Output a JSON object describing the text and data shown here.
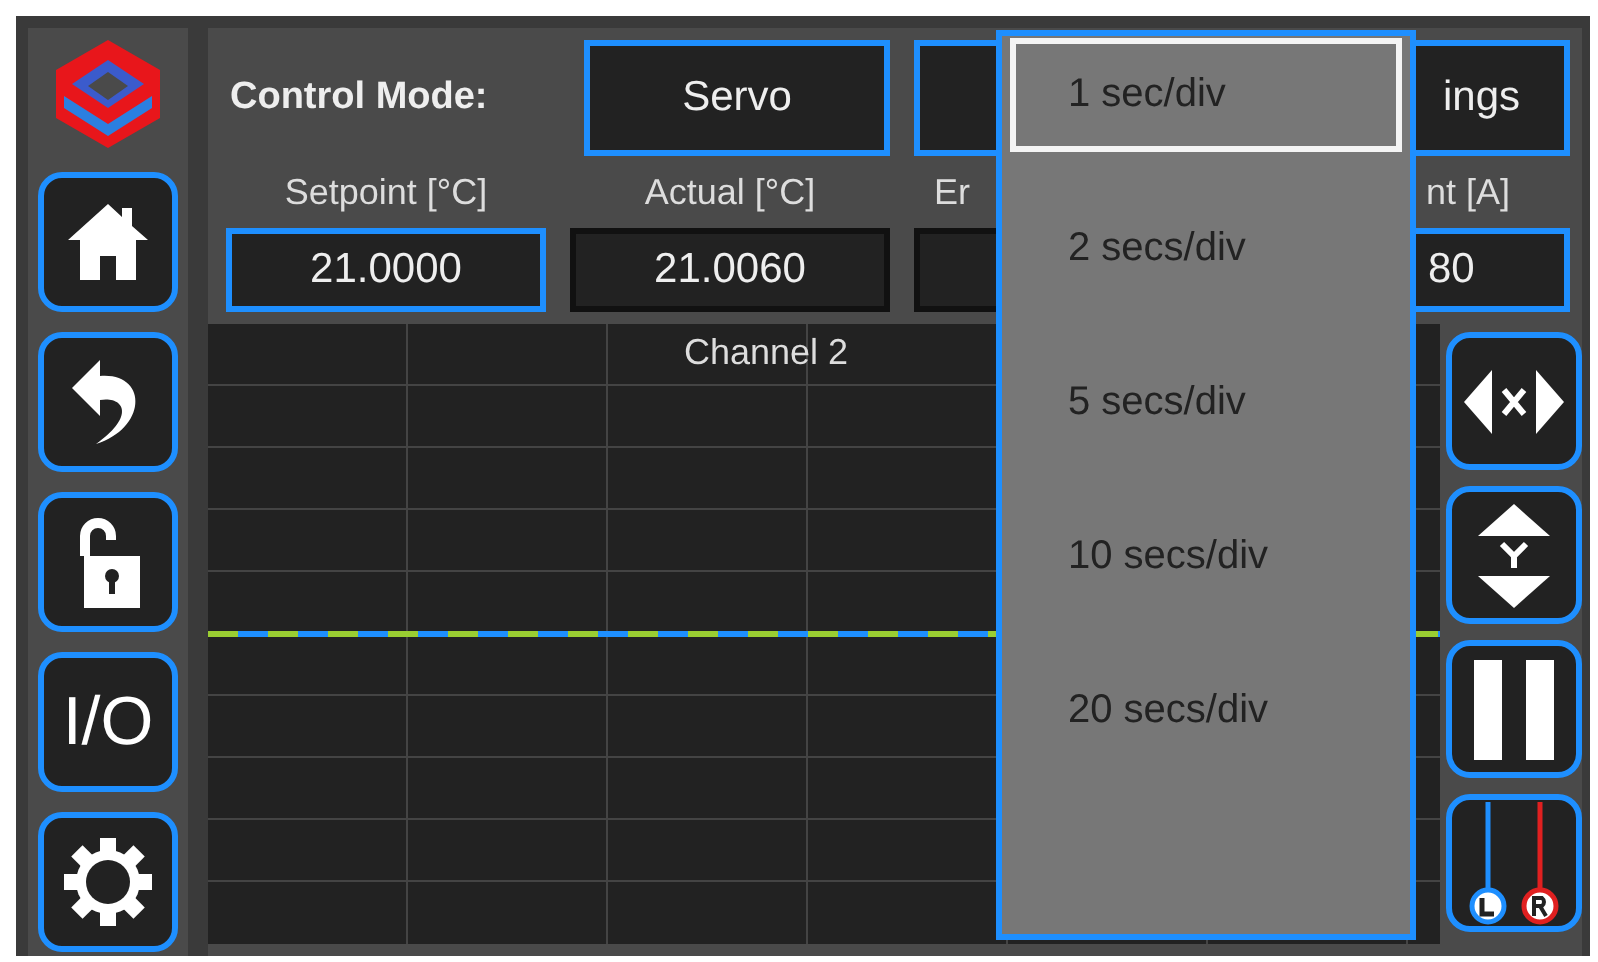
{
  "sidebar": {
    "buttons": [
      {
        "kind": "home"
      },
      {
        "kind": "undo"
      },
      {
        "kind": "unlock"
      },
      {
        "kind": "text",
        "label": "I/O"
      },
      {
        "kind": "settings"
      }
    ]
  },
  "control_mode": {
    "label": "Control Mode:",
    "buttons": [
      {
        "label": "Servo"
      },
      {
        "label": "ings"
      }
    ]
  },
  "readouts": [
    {
      "label": "Setpoint [°C]",
      "value": "21.0000",
      "editable": true
    },
    {
      "label": "Actual [°C]",
      "value": "21.0060",
      "editable": false
    },
    {
      "label": "Er",
      "editable": false
    },
    {
      "label": "nt [A]",
      "value": "80",
      "editable": true
    }
  ],
  "chart": {
    "title": "Channel 2"
  },
  "chart_buttons": [
    {
      "kind": "x-zoom"
    },
    {
      "kind": "y-zoom"
    },
    {
      "kind": "pause"
    },
    {
      "kind": "probes"
    }
  ],
  "timebase_menu": {
    "items": [
      {
        "label": "1 sec/div",
        "selected": true
      },
      {
        "label": "2 secs/div",
        "selected": false
      },
      {
        "label": "5 secs/div",
        "selected": false
      },
      {
        "label": "10 secs/div",
        "selected": false
      },
      {
        "label": "20 secs/div",
        "selected": false
      }
    ]
  }
}
